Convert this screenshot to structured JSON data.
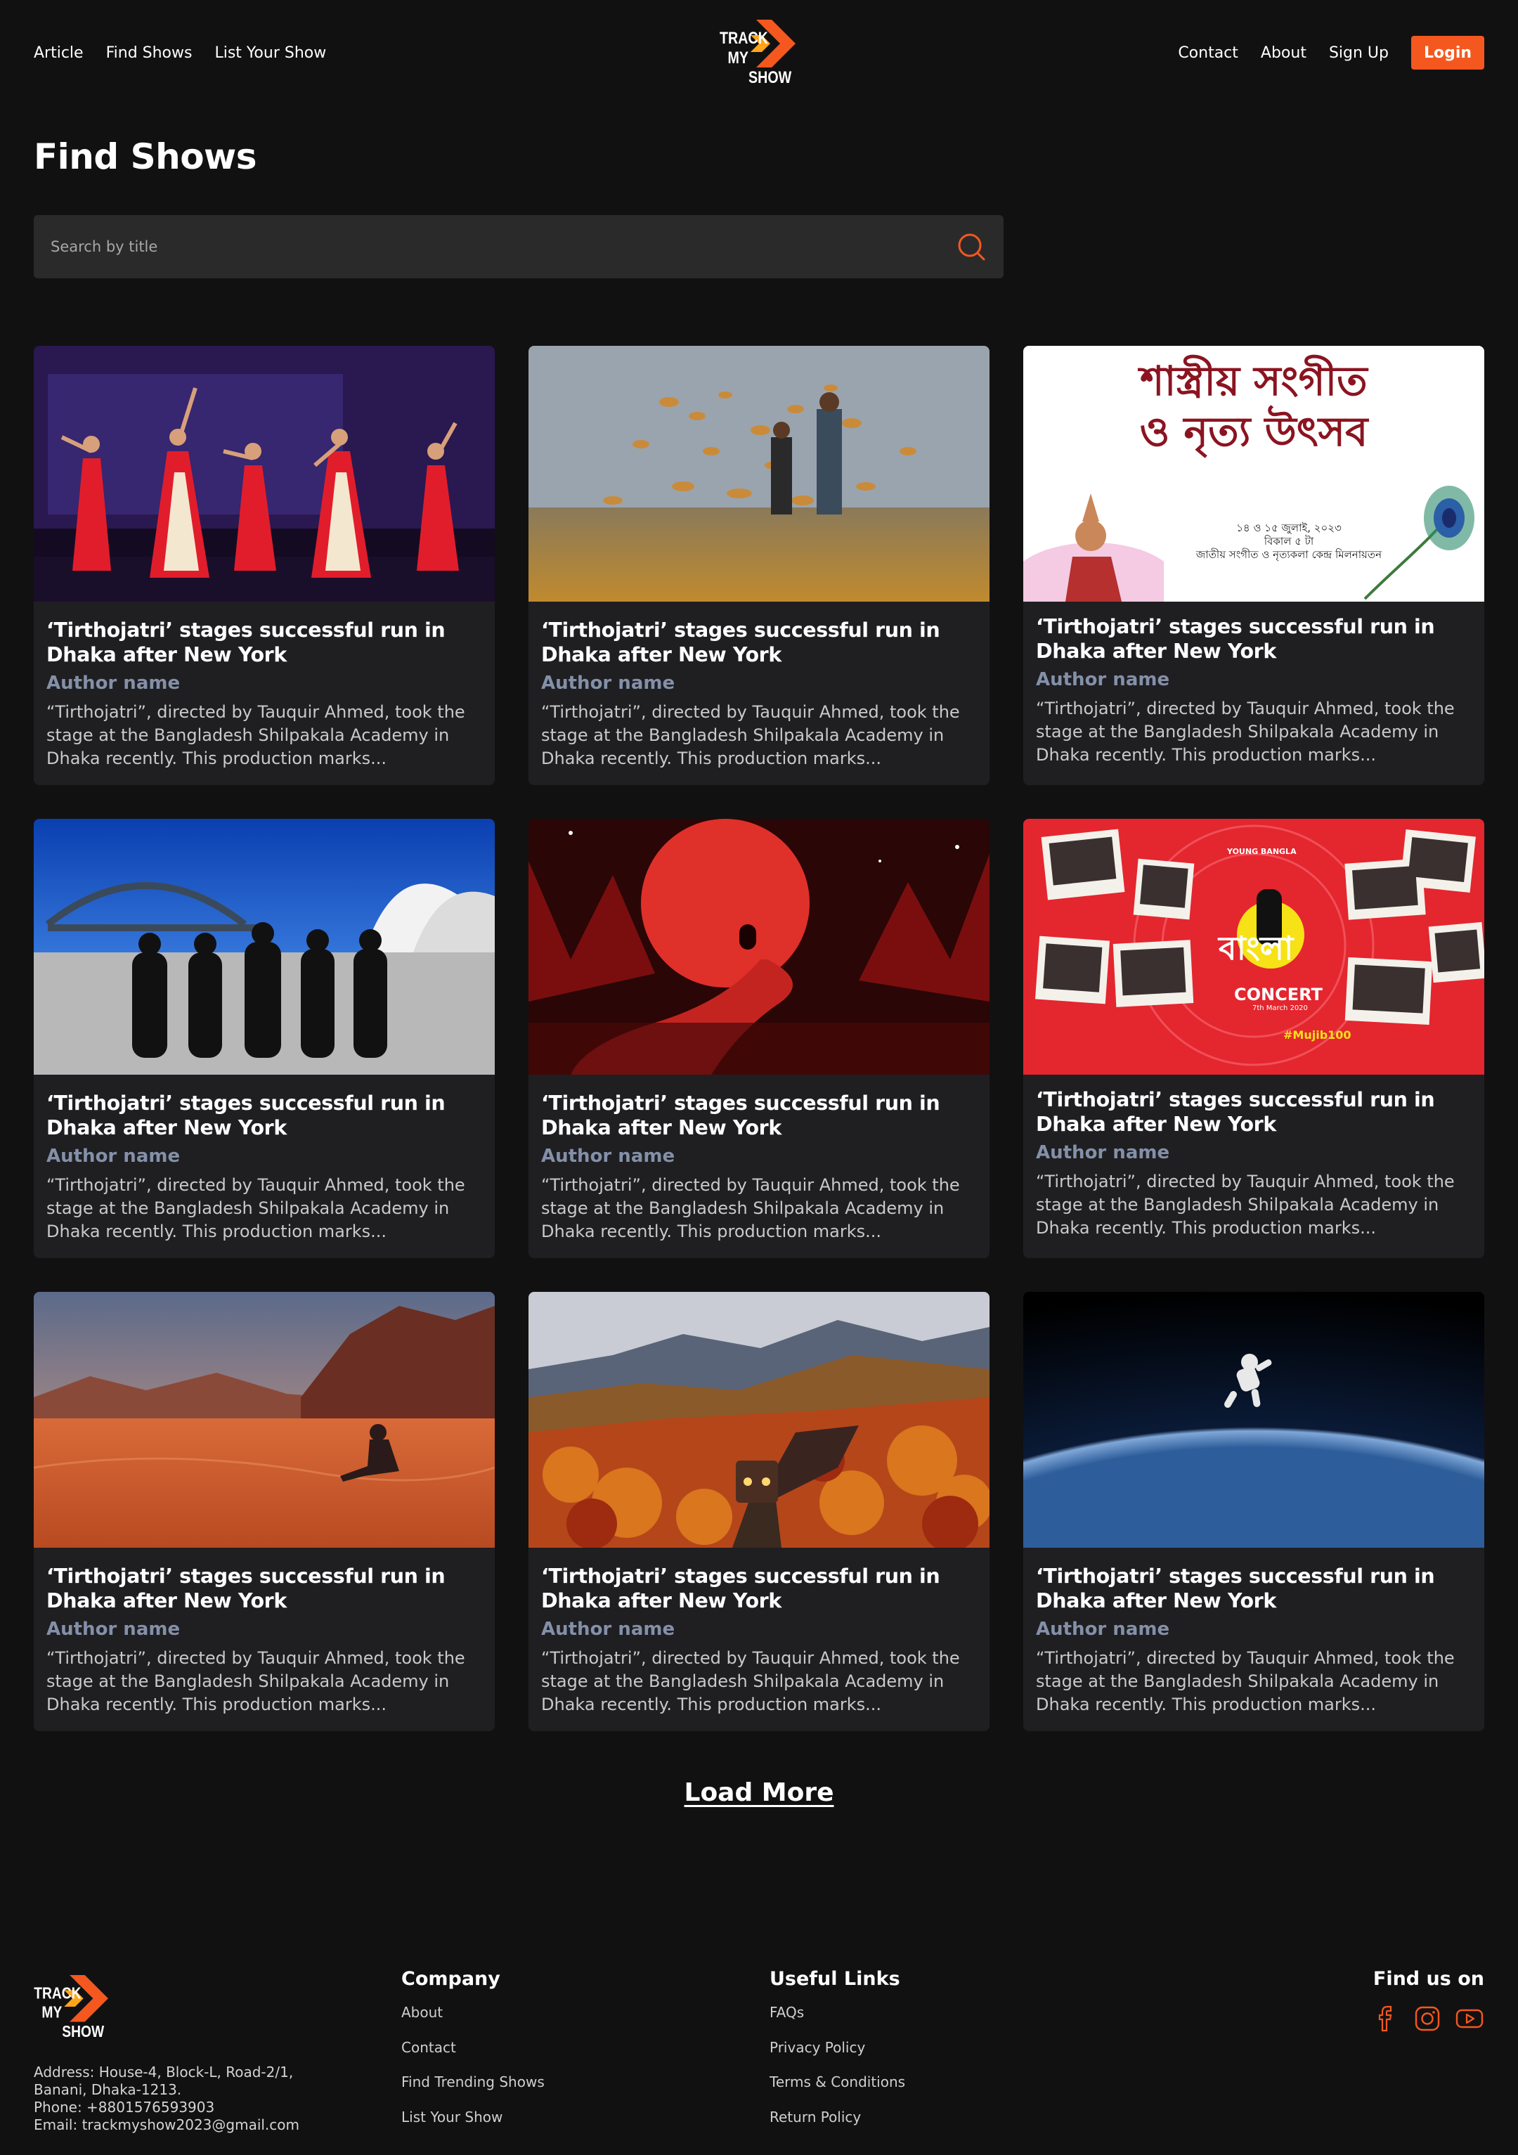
{
  "nav": {
    "left": [
      "Article",
      "Find Shows",
      "List Your Show"
    ],
    "right": [
      "Contact",
      "About",
      "Sign Up"
    ],
    "login": "Login",
    "logo_text": [
      "TRACK",
      "MY",
      "SHOW"
    ]
  },
  "page_title": "Find Shows",
  "search": {
    "placeholder": "Search by title"
  },
  "cards": [
    {
      "title": "‘Tirthojatri’ stages successful run in Dhaka after New York",
      "author": "Author name",
      "excerpt": "“Tirthojatri”, directed by Tauquir Ahmed, took the stage at the Bangladesh Shilpakala Academy in Dhaka recently. This production marks..."
    },
    {
      "title": "‘Tirthojatri’ stages successful run in Dhaka after New York",
      "author": "Author name",
      "excerpt": "“Tirthojatri”, directed by Tauquir Ahmed, took the stage at the Bangladesh Shilpakala Academy in Dhaka recently. This production marks..."
    },
    {
      "title": "‘Tirthojatri’ stages successful run in Dhaka after New York",
      "author": "Author name",
      "excerpt": "“Tirthojatri”, directed by Tauquir Ahmed, took the stage at the Bangladesh Shilpakala Academy in Dhaka recently. This production marks..."
    },
    {
      "title": "‘Tirthojatri’ stages successful run in Dhaka after New York",
      "author": "Author name",
      "excerpt": "“Tirthojatri”, directed by Tauquir Ahmed, took the stage at the Bangladesh Shilpakala Academy in Dhaka recently. This production marks..."
    },
    {
      "title": "‘Tirthojatri’ stages successful run in Dhaka after New York",
      "author": "Author name",
      "excerpt": "“Tirthojatri”, directed by Tauquir Ahmed, took the stage at the Bangladesh Shilpakala Academy in Dhaka recently. This production marks..."
    },
    {
      "title": "‘Tirthojatri’ stages successful run in Dhaka after New York",
      "author": "Author name",
      "excerpt": "“Tirthojatri”, directed by Tauquir Ahmed, took the stage at the Bangladesh Shilpakala Academy in Dhaka recently. This production marks..."
    },
    {
      "title": "‘Tirthojatri’ stages successful run in Dhaka after New York",
      "author": "Author name",
      "excerpt": "“Tirthojatri”, directed by Tauquir Ahmed, took the stage at the Bangladesh Shilpakala Academy in Dhaka recently. This production marks..."
    },
    {
      "title": "‘Tirthojatri’ stages successful run in Dhaka after New York",
      "author": "Author name",
      "excerpt": "“Tirthojatri”, directed by Tauquir Ahmed, took the stage at the Bangladesh Shilpakala Academy in Dhaka recently. This production marks..."
    },
    {
      "title": "‘Tirthojatri’ stages successful run in Dhaka after New York",
      "author": "Author name",
      "excerpt": "“Tirthojatri”, directed by Tauquir Ahmed, took the stage at the Bangladesh Shilpakala Academy in Dhaka recently. This production marks..."
    }
  ],
  "poster_bengali": {
    "title_line1": "শাস্ত্রীয় সংগীত",
    "title_line2": "ও নৃত্য উৎসব",
    "date": "১৪ ও ১৫ জুলাই, ২০২৩",
    "time": "বিকাল ৫ টা",
    "venue": "জাতীয় সংগীত ও নৃত্যকলা কেন্দ্র মিলনায়তন"
  },
  "poster_concert": {
    "top_label": "YOUNG BANGLA",
    "title": "বাংলা",
    "subtitle": "CONCERT",
    "date": "7th March 2020",
    "hashtag": "#Mujib100"
  },
  "load_more": "Load More",
  "footer": {
    "address": [
      "Address: House-4, Block-L, Road-2/1,",
      "Banani, Dhaka-1213.",
      "Phone:  +8801576593903",
      "Email:  trackmyshow2023@gmail.com"
    ],
    "company_heading": "Company",
    "company_links": [
      "About",
      "Contact",
      "Find Trending Shows",
      "List Your Show"
    ],
    "links_heading": "Useful Links",
    "useful_links": [
      "FAQs",
      "Privacy Policy",
      "Terms & Conditions",
      "Return Policy"
    ],
    "social_heading": "Find us on",
    "social_icons": [
      "facebook-icon",
      "instagram-icon",
      "youtube-icon"
    ]
  },
  "colors": {
    "accent": "#f4581f",
    "background": "#121112",
    "card": "#1f1e21",
    "author": "#8390a8"
  }
}
